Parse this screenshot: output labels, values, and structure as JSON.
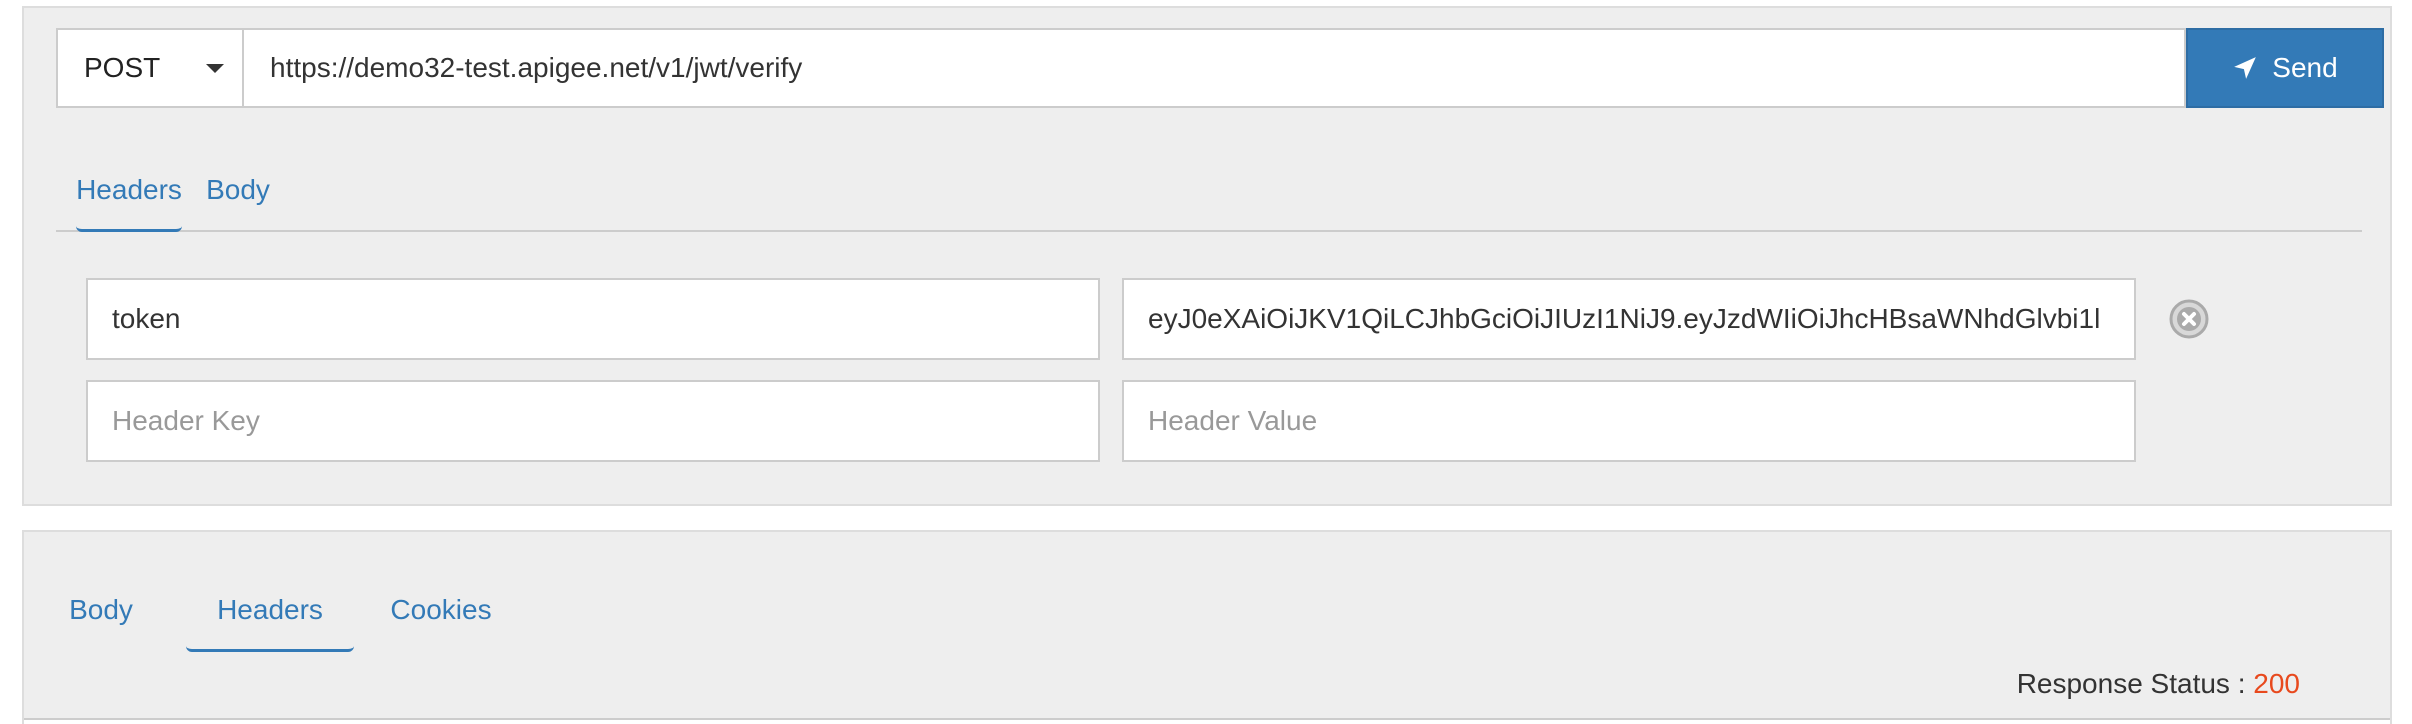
{
  "request": {
    "method": "POST",
    "url": "https://demo32-test.apigee.net/v1/jwt/verify",
    "send_label": "Send",
    "send_icon": "paper-plane-icon",
    "tabs": [
      {
        "label": "Headers",
        "active": true
      },
      {
        "label": "Body",
        "active": false
      }
    ],
    "headers": [
      {
        "key": "token",
        "value": "eyJ0eXAiOiJKV1QiLCJhbGciOiJIUzI1NiJ9.eyJzdWIiOiJhcHBsaWNhdGlvbi1l"
      }
    ],
    "new_header": {
      "key_placeholder": "Header Key",
      "value_placeholder": "Header Value"
    }
  },
  "response": {
    "tabs": [
      {
        "label": "Body",
        "active": false
      },
      {
        "label": "Headers",
        "active": true
      },
      {
        "label": "Cookies",
        "active": false
      }
    ],
    "status_label": "Response Status :",
    "status_code": "200"
  },
  "colors": {
    "accent": "#337ab7",
    "status_code": "#e8491d",
    "panel_bg": "#eeeeee"
  }
}
